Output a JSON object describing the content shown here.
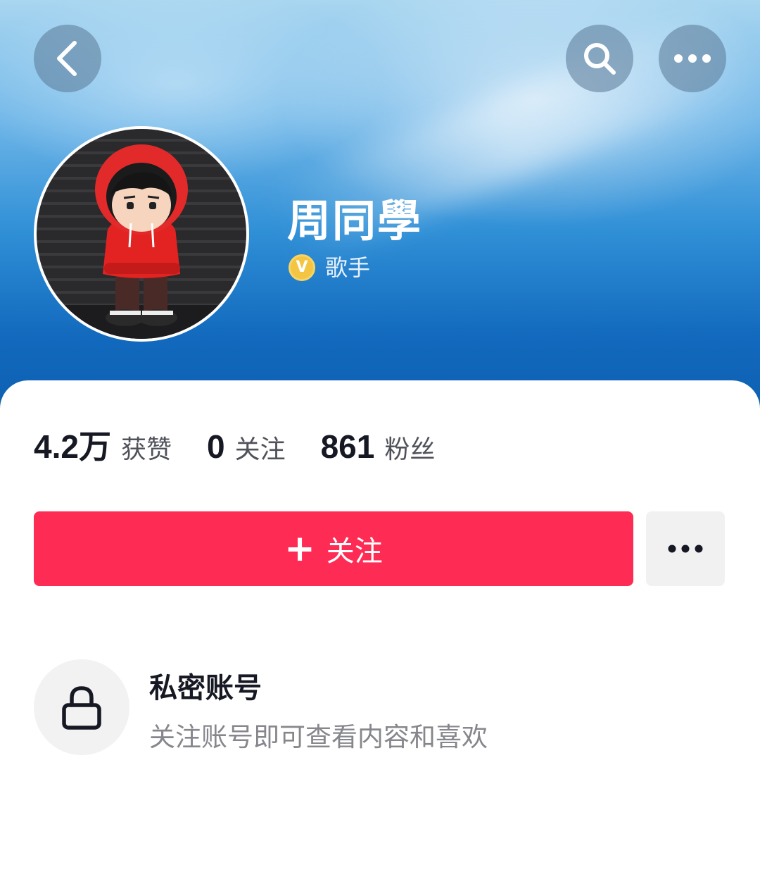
{
  "header": {
    "back_icon": "chevron-left-icon",
    "search_icon": "search-icon",
    "more_icon": "ellipsis-icon"
  },
  "profile": {
    "name": "周同學",
    "badge_letter": "V",
    "badge_label": "歌手",
    "avatar": "red-hoodie-figure"
  },
  "stats": [
    {
      "value": "4.2万",
      "label": "获赞"
    },
    {
      "value": "0",
      "label": "关注"
    },
    {
      "value": "861",
      "label": "粉丝"
    }
  ],
  "actions": {
    "follow_plus": "+",
    "follow_label": "关注",
    "more_icon": "ellipsis-icon"
  },
  "private_notice": {
    "title": "私密账号",
    "description": "关注账号即可查看内容和喜欢",
    "icon": "lock-icon"
  },
  "colors": {
    "follow_button": "#fe2c55",
    "hero_top": "#a9d6f0",
    "hero_bottom": "#0d5fb0",
    "badge_gold": "#f4c542"
  }
}
